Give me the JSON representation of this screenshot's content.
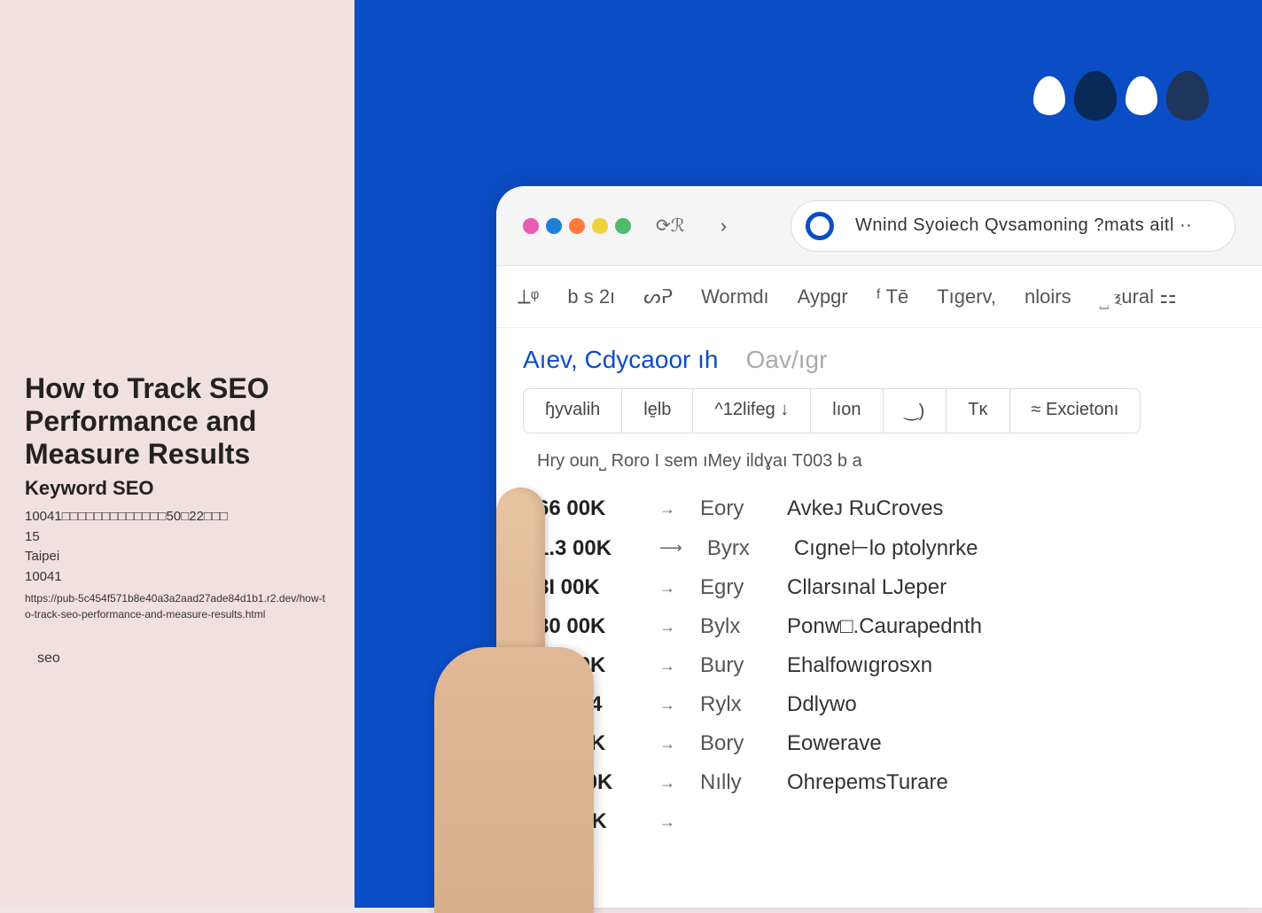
{
  "left": {
    "title": "How to Track SEO Performance and Measure Results",
    "subtitle": "Keyword SEO",
    "address_line": "10041□□□□□□□□□□□□□50□22□□□",
    "floor": "15",
    "city": "Taipei",
    "postal": "10041",
    "url": "https://pub-5c454f571b8e40a3a2aad27ade84d1b1.r2.dev/how-to-track-seo-performance-and-measure-results.html",
    "tag": "seo"
  },
  "browser": {
    "search_text": "Wnind Syoiech Qvsamoning ?mats aitl ··",
    "dot_colors": [
      "#e85bb2",
      "#1e7fd6",
      "#ff7b3e",
      "#f0d23a",
      "#4ebd6b"
    ],
    "tabs": [
      "⟂ᵠ",
      "b s 2ı",
      "ᔕᕈ",
      "Wormdı",
      "Aypgr",
      "ᶠ Tē",
      "Tıgerv,",
      "nloirs",
      "⎵ ⲝural ⚏"
    ],
    "breadcrumb_main": "Aıev, Cdycaoor ıh",
    "breadcrumb_muted": "Oav/ıgr",
    "filters": [
      "ɧyvalih",
      "le̱lb",
      "^12lifeg ↓",
      "lıon",
      "‿)",
      "Tᴋ",
      "≈ Excietonı"
    ],
    "subheader": "Hry oun⎵   Roro   I sem ıMey ildɣaı T003 b a",
    "rows": [
      {
        "metric": "66 00K",
        "arrow": "→",
        "mid": "Eory",
        "label": "Avkeᴊ   RuCroves"
      },
      {
        "metric": "1.3 00K",
        "arrow": "⟶",
        "mid": "Byrx",
        "label": "Cıgne⊢lo ptolynrke"
      },
      {
        "metric": "8I 00K",
        "arrow": "→",
        "mid": "Egry",
        "label": "Cllarsınal LJeper"
      },
      {
        "metric": "80 00K",
        "arrow": "→",
        "mid": "Bylx",
        "label": "Ponw□.Caurapednth"
      },
      {
        "metric": "32 00K",
        "arrow": "→",
        "mid": "Bury",
        "label": "Ehalfowıgrosxn"
      },
      {
        "metric": "17 004",
        "arrow": "→",
        "mid": "Rylx",
        "label": "Ddlywo"
      },
      {
        "metric": "32 00K",
        "arrow": "→",
        "mid": "Bory",
        "label": "Eowerave"
      },
      {
        "metric": "SO 00K",
        "arrow": "→",
        "mid": "Nılly",
        "label": "OhrepemsTurare"
      },
      {
        "metric": "8Ł 00K",
        "arrow": "→",
        "mid": "",
        "label": ""
      }
    ]
  },
  "logo_colors": [
    "#0a4dc4",
    "#092a57",
    "#0a4dc4",
    "#1e365c"
  ]
}
